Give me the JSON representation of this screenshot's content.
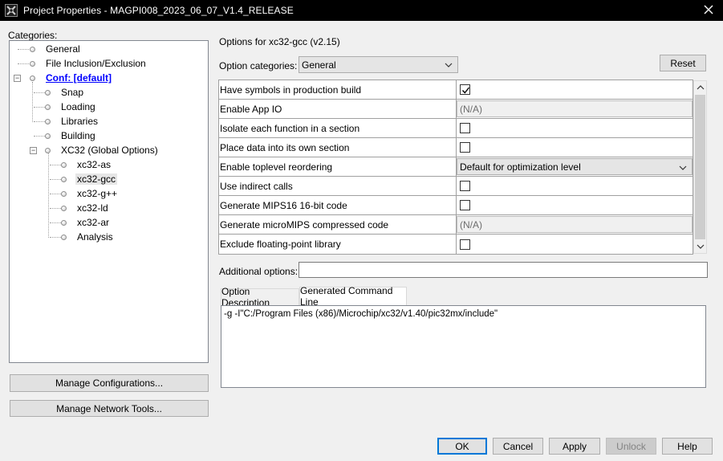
{
  "window": {
    "title": "Project Properties - MAGPI008_2023_06_07_V1.4_RELEASE"
  },
  "categories": {
    "label": "Categories:",
    "items": [
      {
        "label": "General"
      },
      {
        "label": "File Inclusion/Exclusion"
      },
      {
        "label": "Conf: [default]"
      },
      {
        "label": "Snap"
      },
      {
        "label": "Loading"
      },
      {
        "label": "Libraries"
      },
      {
        "label": "Building"
      },
      {
        "label": "XC32 (Global Options)"
      },
      {
        "label": "xc32-as"
      },
      {
        "label": "xc32-gcc"
      },
      {
        "label": "xc32-g++"
      },
      {
        "label": "xc32-ld"
      },
      {
        "label": "xc32-ar"
      },
      {
        "label": "Analysis"
      }
    ],
    "selected": "xc32-gcc"
  },
  "left_buttons": {
    "manage_configurations": "Manage Configurations...",
    "manage_network_tools": "Manage Network Tools..."
  },
  "options": {
    "header": "Options for xc32-gcc (v2.15)",
    "category_label": "Option categories:",
    "category_value": "General",
    "reset": "Reset",
    "rows": [
      {
        "name": "Have symbols in production build",
        "type": "checkbox",
        "checked": true
      },
      {
        "name": "Enable App IO",
        "type": "na",
        "value": "(N/A)"
      },
      {
        "name": "Isolate each function in a section",
        "type": "checkbox",
        "checked": false
      },
      {
        "name": "Place data into its own section",
        "type": "checkbox",
        "checked": false
      },
      {
        "name": "Enable toplevel reordering",
        "type": "select",
        "value": "Default for optimization level"
      },
      {
        "name": "Use indirect calls",
        "type": "checkbox",
        "checked": false
      },
      {
        "name": "Generate MIPS16 16-bit code",
        "type": "checkbox",
        "checked": false
      },
      {
        "name": "Generate microMIPS compressed code",
        "type": "na",
        "value": "(N/A)"
      },
      {
        "name": "Exclude floating-point library",
        "type": "checkbox",
        "checked": false
      }
    ],
    "additional_label": "Additional options:",
    "additional_value": ""
  },
  "tabs": {
    "option_description": "Option Description",
    "generated_command_line": "Generated Command Line",
    "active": "generated_command_line",
    "command_line": "-g -I\"C:/Program Files (x86)/Microchip/xc32/v1.40/pic32mx/include\""
  },
  "footer": {
    "ok": "OK",
    "cancel": "Cancel",
    "apply": "Apply",
    "unlock": "Unlock",
    "help": "Help"
  },
  "colors": {
    "titlebar": "#000000",
    "link": "#0000ff",
    "default_button_border": "#0078d7"
  }
}
